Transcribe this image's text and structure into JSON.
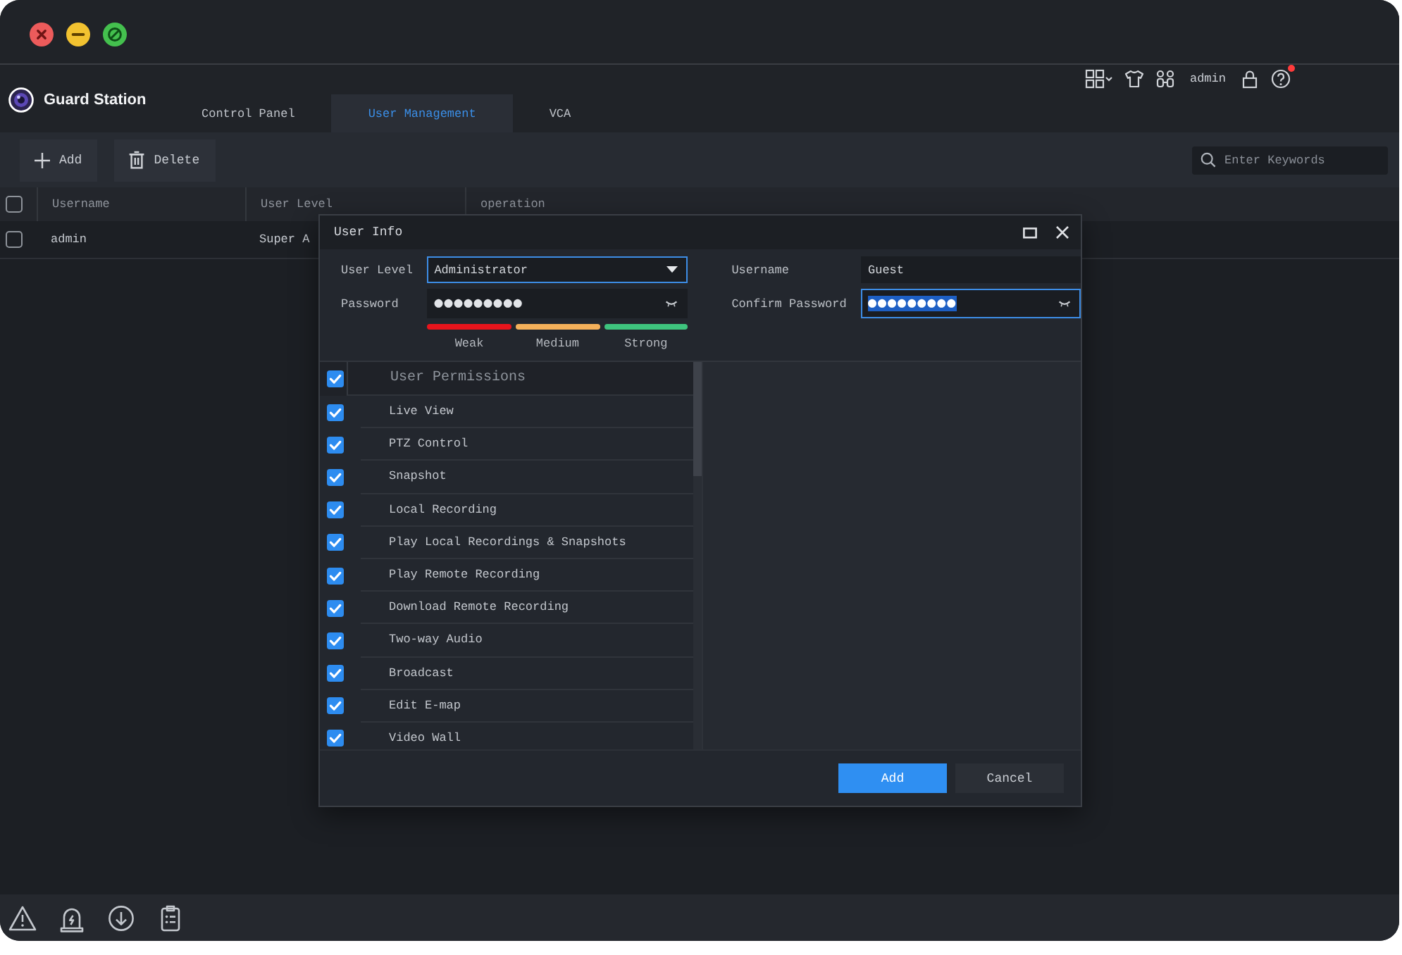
{
  "app": {
    "name": "Guard Station"
  },
  "tabs": [
    {
      "label": "Control Panel",
      "selected": false
    },
    {
      "label": "User Management",
      "selected": true
    },
    {
      "label": "VCA",
      "selected": false
    }
  ],
  "header_tools": {
    "username": "admin",
    "help_badge": true
  },
  "toolbar": {
    "buttons": [
      {
        "kind": "add",
        "label": "Add"
      },
      {
        "kind": "delete",
        "label": "Delete"
      }
    ],
    "search": {
      "placeholder": "Enter Keywords"
    }
  },
  "table": {
    "header_checked": false,
    "columns": [
      "Username",
      "User Level",
      "operation"
    ],
    "rows": [
      {
        "checked": false,
        "cells": [
          "admin",
          "Super A"
        ]
      }
    ]
  },
  "dialog": {
    "title": "User Info",
    "fields": [
      {
        "kind": "dropdown",
        "label": "User Level",
        "value": "Administrator",
        "highlighted": true,
        "text_selected": false
      },
      {
        "kind": "text",
        "label": "Username",
        "value": "Guest",
        "highlighted": false,
        "text_selected": false
      },
      {
        "kind": "password",
        "label": "Password",
        "value": "●●●●●●●●●",
        "highlighted": false,
        "text_selected": false
      },
      {
        "kind": "password",
        "label": "Confirm Password",
        "value": "●●●●●●●●●",
        "highlighted": true,
        "text_selected": true
      }
    ],
    "strength_levels": [
      {
        "label": "Weak",
        "color": "#e8141c"
      },
      {
        "label": "Medium",
        "color": "#f4b05a"
      },
      {
        "label": "Strong",
        "color": "#3ec47e"
      }
    ],
    "permissions": {
      "label": "User Permissions",
      "checked": true,
      "items": [
        {
          "label": "Live View",
          "checked": true
        },
        {
          "label": "PTZ Control",
          "checked": true
        },
        {
          "label": "Snapshot",
          "checked": true
        },
        {
          "label": "Local Recording",
          "checked": true
        },
        {
          "label": "Play Local Recordings & Snapshots",
          "checked": true
        },
        {
          "label": "Play Remote Recording",
          "checked": true
        },
        {
          "label": "Download Remote Recording",
          "checked": true
        },
        {
          "label": "Two-way Audio",
          "checked": true
        },
        {
          "label": "Broadcast",
          "checked": true
        },
        {
          "label": "Edit E-map",
          "checked": true
        },
        {
          "label": "Video Wall",
          "checked": true
        }
      ]
    },
    "buttons": [
      {
        "kind": "primary",
        "label": "Add"
      },
      {
        "kind": "secondary",
        "label": "Cancel"
      }
    ]
  }
}
